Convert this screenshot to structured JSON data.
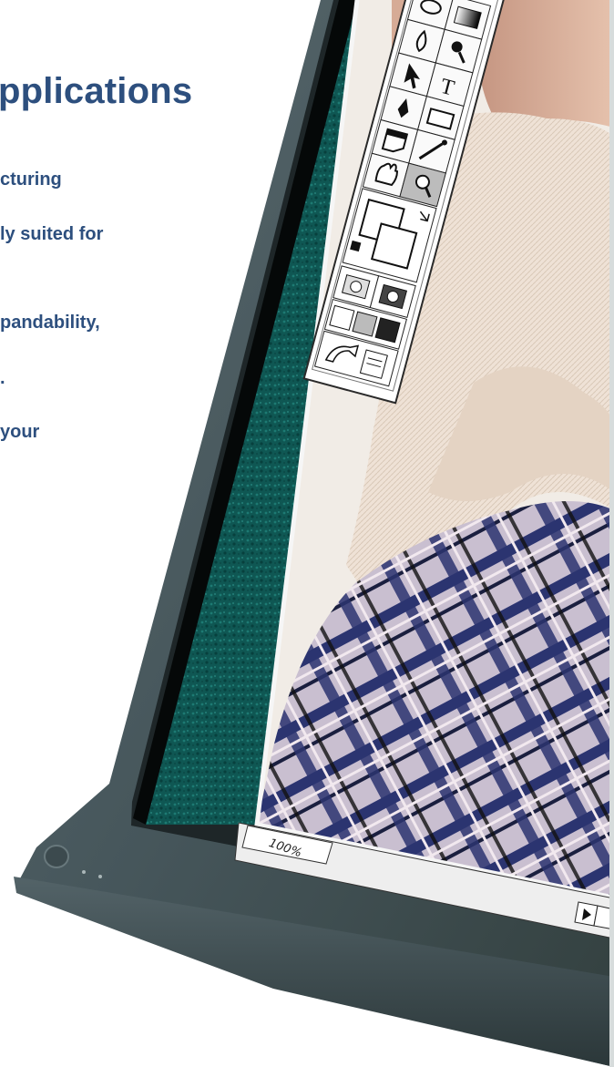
{
  "brochure": {
    "headline": "pplications",
    "body_lines": [
      "cturing",
      "ly suited for",
      "pandability,",
      ".",
      "your"
    ]
  },
  "editor_window": {
    "zoom_level": "100%",
    "tool_icons": [
      "lasso-icon",
      "gradient-icon",
      "water-drop-icon",
      "magnifier-icon",
      "arrow-icon",
      "text-tool-icon",
      "pen-icon",
      "rectangle-icon",
      "page-curl-icon",
      "eyedropper-icon",
      "hand-icon",
      "zoom-icon",
      "color-swatch-icon",
      "mask-mode-icon",
      "screen-mode-icon",
      "jump-icon"
    ]
  },
  "colors": {
    "brand_text": "#2d4f7e",
    "monitor_bezel": "#46575c",
    "teal_texture": "#0f5a56"
  }
}
